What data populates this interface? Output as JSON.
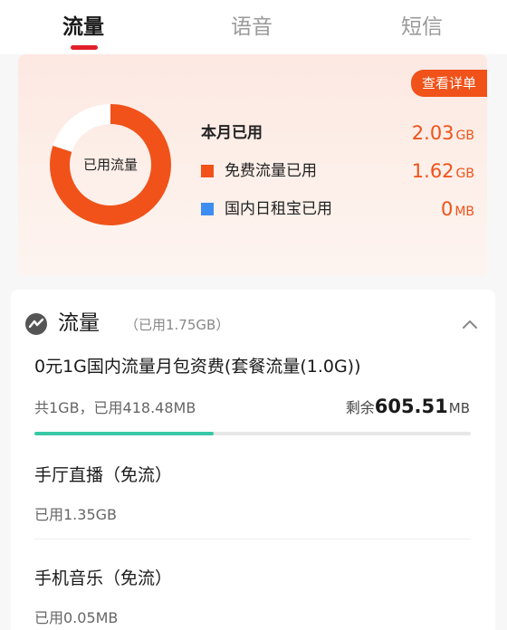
{
  "tabs": [
    {
      "label": "流量",
      "active": true
    },
    {
      "label": "语音",
      "active": false
    },
    {
      "label": "短信",
      "active": false
    }
  ],
  "summary": {
    "detail_button": "查看详单",
    "donut_label": "已用流量",
    "donut_used_fraction": 0.8,
    "month_used": {
      "label": "本月已用",
      "value": "2.03",
      "unit": "GB"
    },
    "free_used": {
      "label": "免费流量已用",
      "value": "1.62",
      "unit": "GB",
      "color": "#f0521a"
    },
    "domestic_day_used": {
      "label": "国内日租宝已用",
      "value": "0",
      "unit": "MB",
      "color": "#3d8df2"
    }
  },
  "flow_section": {
    "title": "流量",
    "subtitle": "（已用1.75GB）",
    "package": {
      "name": "0元1G国内流量月包资费(套餐流量(1.0G))",
      "usage": "共1GB，已用418.48MB",
      "remain_label": "剩余",
      "remain_value": "605.51",
      "remain_unit": "MB",
      "used_fraction": 0.41
    },
    "free_items": [
      {
        "name": "手厅直播（免流）",
        "used": "已用1.35GB"
      },
      {
        "name": "手机音乐（免流）",
        "used": "已用0.05MB"
      }
    ]
  },
  "colors": {
    "accent": "#f0521a",
    "tab_indicator": "#e0202b",
    "progress": "#37c9a6",
    "domestic_day": "#3d8df2"
  }
}
